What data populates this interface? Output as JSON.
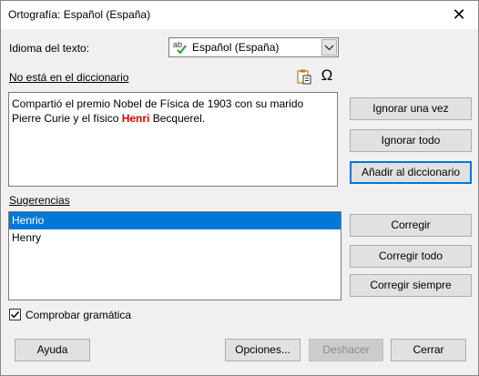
{
  "window": {
    "title": "Ortografía: Español (España)",
    "close_symbol": "✕"
  },
  "language": {
    "label": "Idioma del texto:",
    "value": "Español (España)",
    "icon": "spellcheck-abc-icon"
  },
  "not_in_dictionary": {
    "label": "No está en el diccionario",
    "text_before": "Compartió el premio Nobel de Física de 1903 con su marido Pierre Curie y el físico ",
    "error_word": "Henri",
    "text_after": " Becquerel.",
    "icons": [
      "paste-icon",
      "special-character-omega-icon"
    ],
    "omega_symbol": "Ω"
  },
  "suggestions": {
    "label": "Sugerencias",
    "items": [
      "Henrio",
      "Henry"
    ],
    "selected_index": 0
  },
  "side_buttons": {
    "ignore_once": "Ignorar una vez",
    "ignore_all": "Ignorar todo",
    "add_to_dictionary": "Añadir al diccionario",
    "correct": "Corregir",
    "correct_all": "Corregir todo",
    "always_correct": "Corregir siempre"
  },
  "check_grammar": {
    "label": "Comprobar gramática",
    "checked": true
  },
  "footer": {
    "help": "Ayuda",
    "options": "Opciones...",
    "undo": "Deshacer",
    "close": "Cerrar"
  },
  "colors": {
    "error_word": "#e00000",
    "selection": "#0078d7",
    "focus_border": "#0078d7"
  }
}
